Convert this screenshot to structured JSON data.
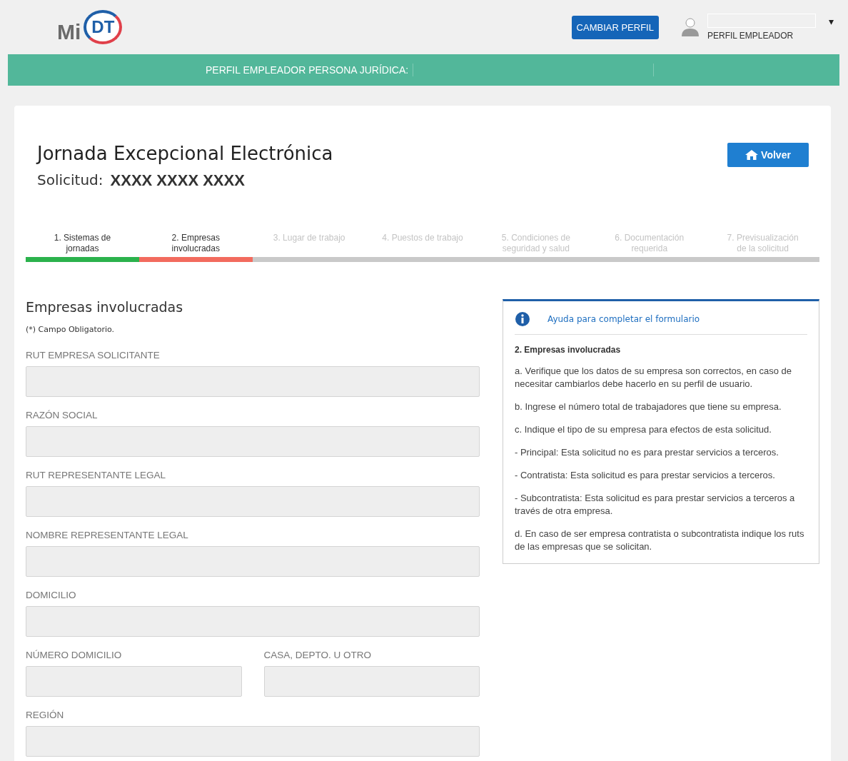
{
  "header": {
    "logo_text": "Mi",
    "logo_badge": "DT",
    "change_profile_button": "CAMBIAR PERFIL",
    "user_role": "PERFIL EMPLEADOR",
    "dropdown_caret": "▾"
  },
  "profile_bar": {
    "label": "PERFIL EMPLEADOR PERSONA JURÍDICA:"
  },
  "page": {
    "title": "Jornada Excepcional Electrónica",
    "request_label": "Solicitud:",
    "request_number": "XXXX XXXX XXXX",
    "back_button": "Volver"
  },
  "steps": [
    {
      "label": "1. Sistemas de jornadas",
      "completed": true,
      "selected": false
    },
    {
      "label": "2. Empresas involucradas",
      "completed": false,
      "selected": true
    },
    {
      "label": "3. Lugar de trabajo",
      "completed": false,
      "selected": false
    },
    {
      "label": "4. Puestos de trabajo",
      "completed": false,
      "selected": false
    },
    {
      "label": "5. Condiciones de seguridad y salud",
      "completed": false,
      "selected": false
    },
    {
      "label": "6. Documentación requerida",
      "completed": false,
      "selected": false
    },
    {
      "label": "7. Previsualización de la solicitud",
      "completed": false,
      "selected": false
    }
  ],
  "form": {
    "title": "Empresas involucradas",
    "required_note": "(*) Campo Obligatorio.",
    "fields": [
      {
        "label": "RUT EMPRESA SOLICITANTE",
        "kind": "full"
      },
      {
        "label": "RAZÓN SOCIAL",
        "kind": "full"
      },
      {
        "label": "RUT REPRESENTANTE LEGAL",
        "kind": "full"
      },
      {
        "label": "NOMBRE REPRESENTANTE LEGAL",
        "kind": "full"
      },
      {
        "label": "DOMICILIO",
        "kind": "full"
      },
      {
        "label": "NÚMERO DOMICILIO",
        "kind": "half"
      },
      {
        "label": "CASA, DEPTO. U OTRO",
        "kind": "half"
      },
      {
        "label": "REGIÓN",
        "kind": "full"
      }
    ]
  },
  "help": {
    "title": "Ayuda para completar el formulario",
    "section": "2. Empresas involucradas",
    "paragraphs": [
      "a. Verifique que los datos de su empresa son correctos, en caso de necesitar cambiarlos debe hacerlo en su perfil de usuario.",
      "b. Ingrese el número total de trabajadores que tiene su empresa.",
      "c. Indique el tipo de su empresa para efectos de esta solicitud.",
      "- Principal: Esta solicitud no es para prestar servicios a terceros.",
      "- Contratista: Esta solicitud es para prestar servicios a terceros.",
      "- Subcontratista: Esta solicitud es para prestar servicios a terceros a través de otra empresa.",
      "d. En caso de ser empresa contratista o subcontratista indique los ruts de las empresas que se solicitan."
    ]
  }
}
